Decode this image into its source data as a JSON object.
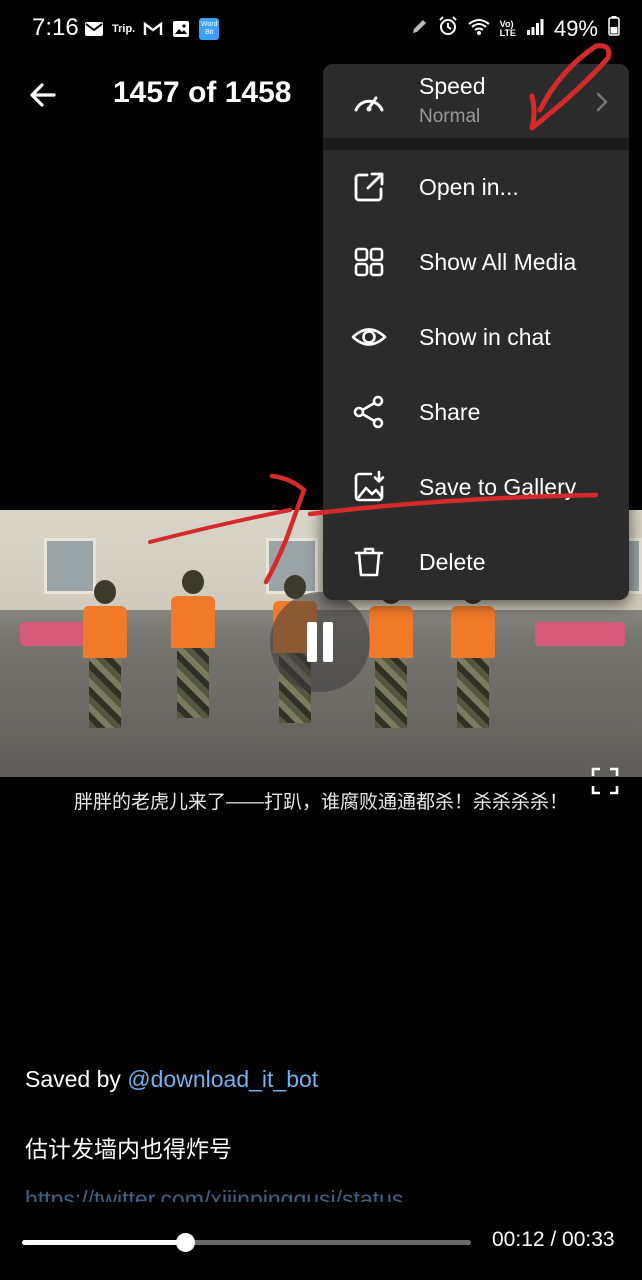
{
  "status_bar": {
    "time": "7:16",
    "left_icons": [
      "mail-icon",
      "trip-icon",
      "gmail-icon",
      "gallery-icon",
      "wordbit-icon"
    ],
    "trip_label": "Trip.",
    "wordbit_label": "Word Bit",
    "battery": "49%",
    "right_icons": [
      "pen-icon",
      "alarm-icon",
      "wifi-icon",
      "volte-icon",
      "signal-icon",
      "battery-icon"
    ]
  },
  "app_bar": {
    "counter": "1457 of 1458"
  },
  "menu": {
    "speed": {
      "label": "Speed",
      "value": "Normal"
    },
    "items": [
      {
        "label": "Open in...",
        "icon": "open-external-icon"
      },
      {
        "label": "Show All Media",
        "icon": "grid-icon"
      },
      {
        "label": "Show in chat",
        "icon": "eye-icon"
      },
      {
        "label": "Share",
        "icon": "share-icon"
      },
      {
        "label": "Save to Gallery",
        "icon": "save-image-icon"
      },
      {
        "label": "Delete",
        "icon": "trash-icon"
      }
    ]
  },
  "video": {
    "subtitle": "胖胖的老虎儿来了——打趴，谁腐败通通都杀！杀杀杀杀！",
    "state": "playing"
  },
  "caption": {
    "saved_by_prefix": "Saved by ",
    "saved_by_link": "@download_it_bot",
    "line2": "估计发墙内也得炸号",
    "line3": "https://twitter.com/xijinpingqusi/status"
  },
  "player": {
    "time_readout": "00:12 / 00:33",
    "progress_fraction": 0.364
  },
  "colors": {
    "background": "#000000",
    "menu_bg": "#2b2b2b",
    "link": "#6fb3f0",
    "annotation": "#d62a2a"
  }
}
